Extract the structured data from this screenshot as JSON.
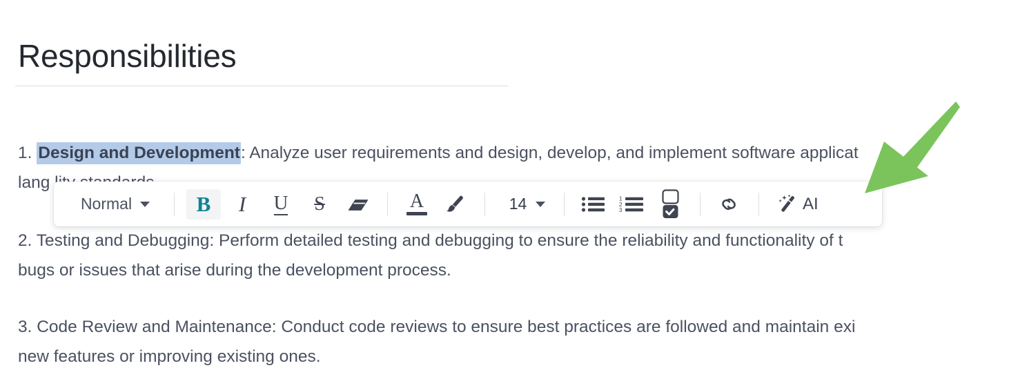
{
  "document": {
    "title": "Responsibilities",
    "paragraphs": [
      {
        "id": "para-1",
        "number": "1.",
        "selected_bold_text": "Design and Development",
        "line1_after_selection": ": Analyze user requirements and design, develop, and implement software applicat",
        "line2": "lang                                                                                                                   lity standards"
      },
      {
        "id": "para-2",
        "line1": "2. Testing and Debugging: Perform detailed testing and debugging to ensure the reliability and functionality of t",
        "line2": "bugs or issues that arise during the development process."
      },
      {
        "id": "para-3",
        "line1": "3. Code Review and Maintenance: Conduct code reviews to ensure best practices are followed and maintain exi",
        "line2": "new features or improving existing ones."
      }
    ]
  },
  "toolbar": {
    "style_select": {
      "value": "Normal",
      "icon": "chevron-down-icon"
    },
    "bold": {
      "label": "B",
      "icon": "bold-icon",
      "active": true
    },
    "italic": {
      "label": "I",
      "icon": "italic-icon",
      "active": false
    },
    "underline": {
      "label": "U",
      "icon": "underline-icon",
      "active": false
    },
    "strikethrough": {
      "label": "S",
      "icon": "strikethrough-icon",
      "active": false
    },
    "clear_format": {
      "icon": "eraser-icon"
    },
    "text_color": {
      "label": "A",
      "icon": "text-color-icon"
    },
    "highlight": {
      "icon": "paint-brush-icon"
    },
    "font_size": {
      "value": "14",
      "icon": "chevron-down-icon"
    },
    "bullet_list": {
      "icon": "bulleted-list-icon"
    },
    "numbered_list": {
      "icon": "numbered-list-icon",
      "markers": [
        "1",
        "2",
        "3"
      ]
    },
    "checklist": {
      "icon": "checklist-icon"
    },
    "link": {
      "icon": "link-icon"
    },
    "ai": {
      "label": "AI",
      "icon": "magic-wand-icon"
    }
  },
  "annotation": {
    "arrow": {
      "color": "#7bc45c",
      "points_to": "ai-button"
    }
  },
  "colors": {
    "accent_teal": "#0f8292",
    "selection_blue": "#b3cbe9",
    "text": "#4a5160",
    "arrow_green": "#7bc45c"
  }
}
